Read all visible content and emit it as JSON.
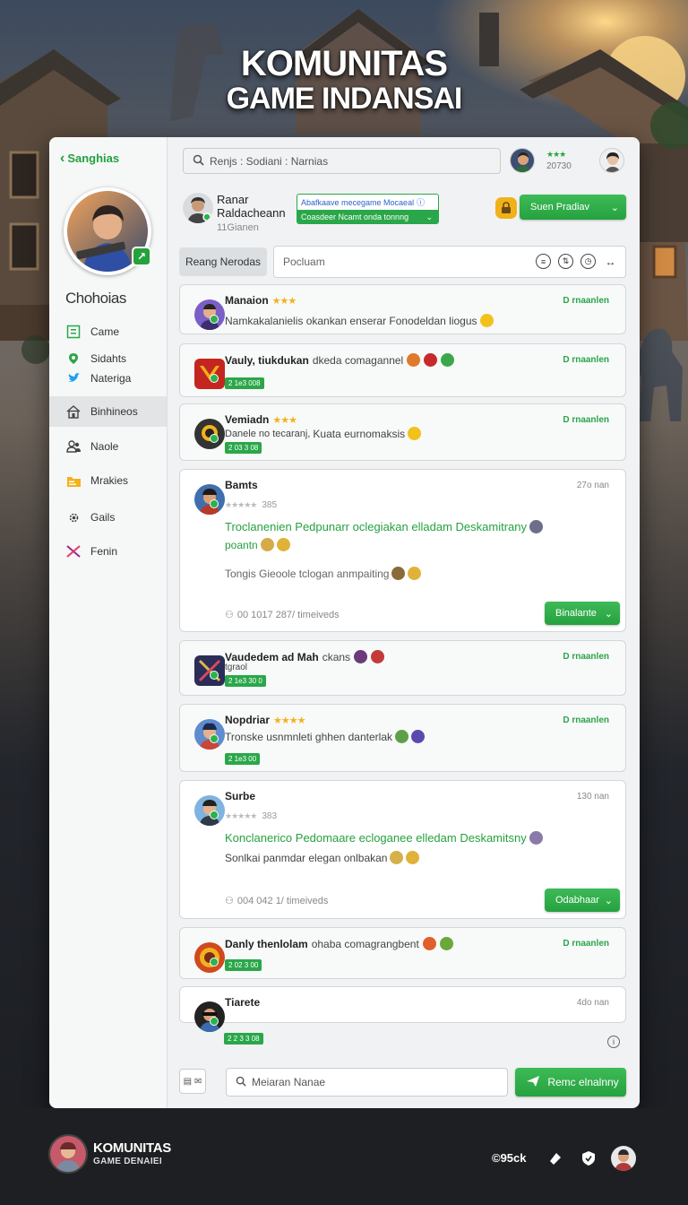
{
  "hero": {
    "line1": "KOMUNITAS",
    "line2": "GAME INDANSAI"
  },
  "sidebar": {
    "back_label": "Sanghias",
    "profile_name": "Chohoias",
    "items": [
      {
        "label": "Came",
        "icon": "game-icon"
      },
      {
        "label": "Sidahts",
        "icon": "location-icon"
      },
      {
        "label": "Nateriga",
        "icon": "twitter-icon"
      },
      {
        "label": "Binhineos",
        "icon": "home-icon",
        "active": true
      },
      {
        "label": "Naole",
        "icon": "people-icon"
      },
      {
        "label": "Mrakies",
        "icon": "folder-icon"
      },
      {
        "label": "Gails",
        "icon": "gear-icon"
      },
      {
        "label": "Fenin",
        "icon": "crossed-swords-icon"
      }
    ]
  },
  "topbar": {
    "search_text": "Renjs : Sodiani : Narnias",
    "stars": "★★★",
    "count": "20730"
  },
  "header": {
    "name1": "Ranar",
    "name2": "Raldacheann",
    "sub": "11Gianen",
    "promo_line1": "Abafkaave mecegame Mocaeal",
    "promo_line2": "Coasdeer Ncamt onda tonnng",
    "action_label": "Suen Pradiav"
  },
  "filter": {
    "chip_label": "Reang Nerodas",
    "placeholder": "Pocluam"
  },
  "posts": [
    {
      "name": "Manaion",
      "stars": "★★★",
      "text": "Namkakalanielis okankan enserar Fonodeldan liogus",
      "time": "D rnaanlen"
    },
    {
      "name": "Vauly, tiukdukan",
      "meta": "dkeda comagannel",
      "tag": "2 1e3 008",
      "time": "D rnaanlen"
    },
    {
      "name": "Vemiadn",
      "stars": "★★★",
      "meta": "Kuata eurnomaksis",
      "text": "Danele no tecaranj,",
      "tag": "2 03 3 08",
      "time": "D rnaanlen"
    },
    {
      "name": "Bamts",
      "rating": "★★★★★",
      "rating_count": "385",
      "green_text": "Troclanenien Pedpunarr oclegiakan elladam Deskamitrany",
      "tag_text": "poantn",
      "text": "Tongis Gieoole tclogan anmpaiting",
      "stats": "00 1017 287/ timeiveds",
      "button": "Binalante",
      "time": "27o nan"
    },
    {
      "name": "Vaudedem ad Mah",
      "meta": "ckans",
      "text": "tgraol",
      "tag": "2 1e3 30 0",
      "time": "D rnaanlen"
    },
    {
      "name": "Nopdriar",
      "stars": "★★★★",
      "text": "Tronske usnmnleti ghhen danterlak",
      "tag": "2 1e3 00",
      "time": "D rnaanlen"
    },
    {
      "name": "Surbe",
      "rating": "★★★★★",
      "rating_count": "383",
      "green_text": "Konclanerico Pedomaare ecloganee elledam Deskamitsny",
      "text": "Sonlkai panmdar elegan onlbakan",
      "stats": "004 042 1/ timeiveds",
      "button": "Odabhaar",
      "time": "130 nan"
    },
    {
      "name": "Danly thenlolam",
      "meta": "ohaba comagrangbent",
      "tag": "2 02 3 00",
      "time": "D rnaanlen"
    },
    {
      "name": "Tiarete",
      "tag": "2 2 3 3 08",
      "time": "4do nan"
    }
  ],
  "composer": {
    "placeholder": "Meiaran Nanae",
    "send_label": "Remc elnalnny"
  },
  "footer": {
    "title": "KOMUNITAS",
    "subtitle": "GAME DENAIEI",
    "handle": "©95ck"
  },
  "colors": {
    "accent_green": "#26a13f",
    "panel": "#f1f2f3",
    "footer": "#1e1f22",
    "gold": "#f2b21c"
  }
}
